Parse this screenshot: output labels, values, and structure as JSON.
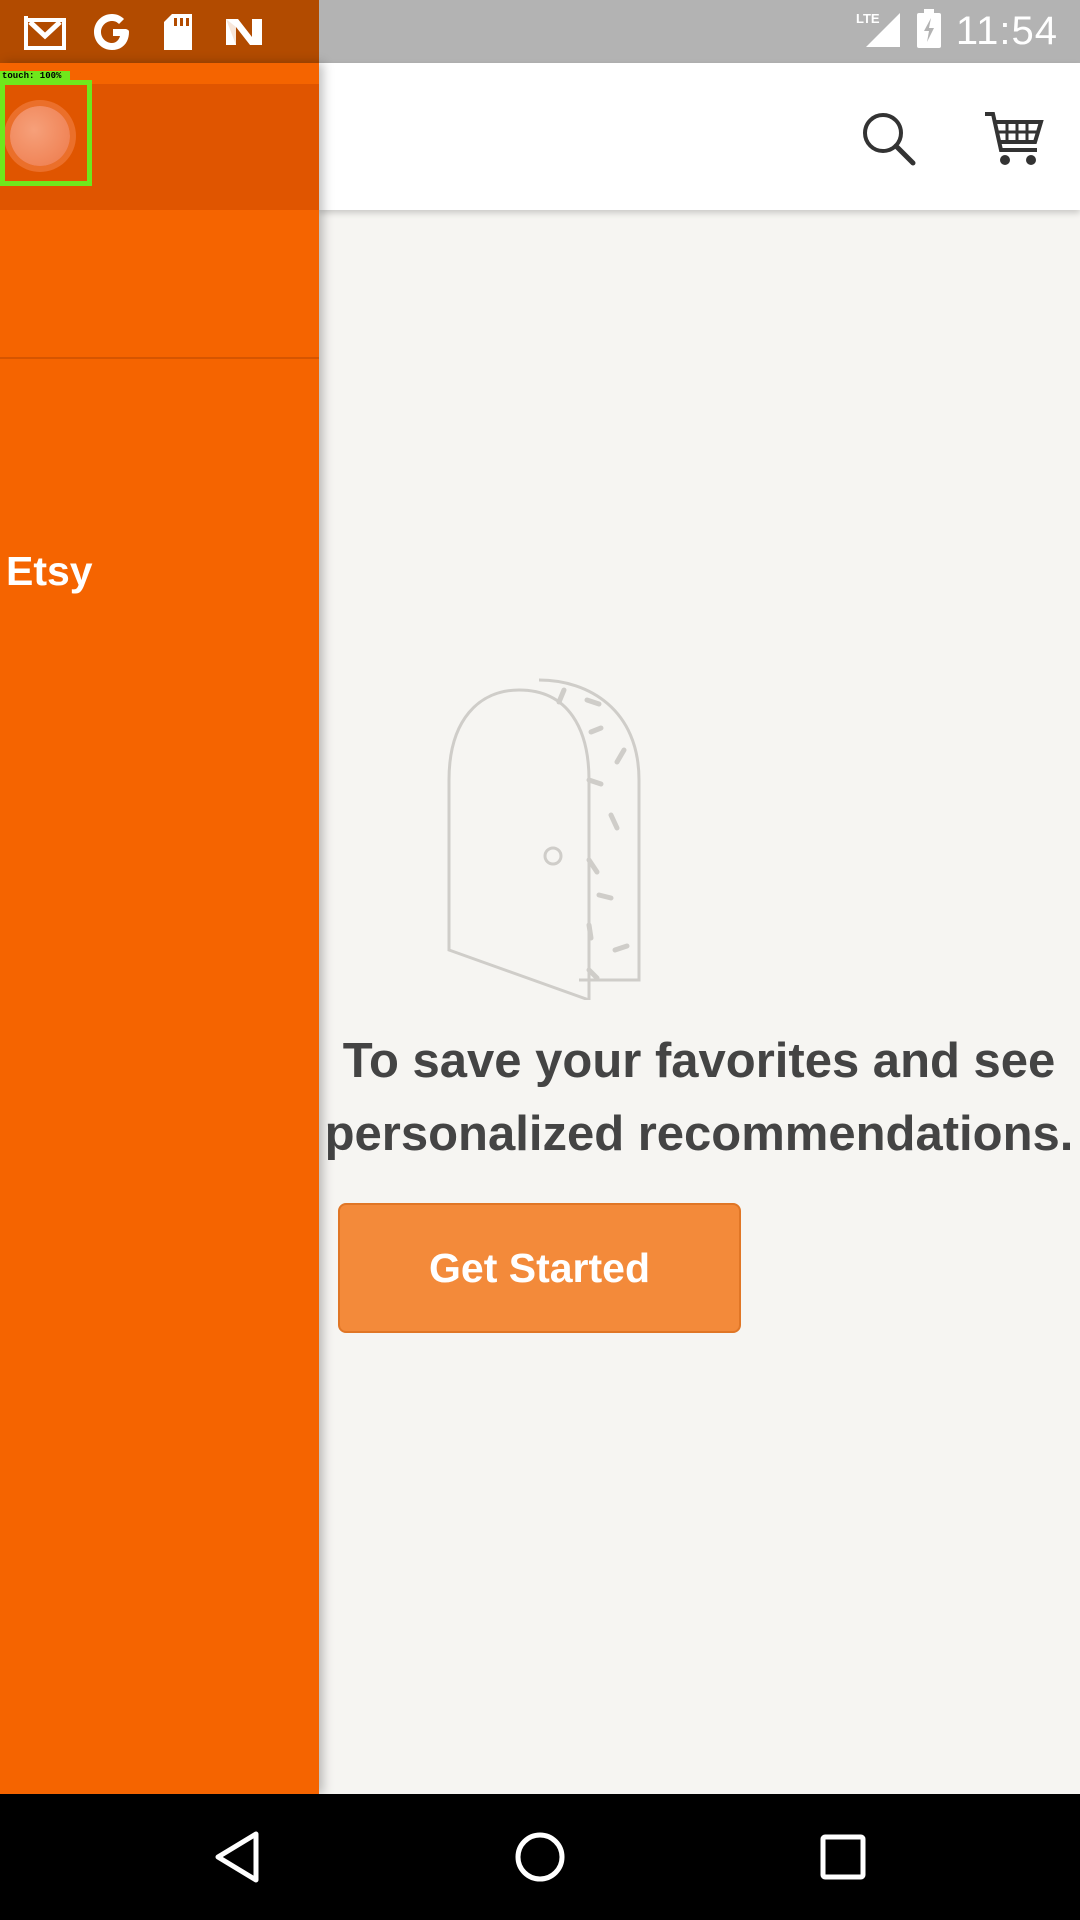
{
  "status_bar": {
    "time": "11:54",
    "network": "LTE",
    "notification_icons": [
      "gmail-icon",
      "google-icon",
      "sd-card-icon",
      "n-app-icon"
    ]
  },
  "app_bar": {
    "actions": [
      "search-icon",
      "cart-icon"
    ]
  },
  "drawer": {
    "touch_overlay": "touch: 100%",
    "items": [
      {
        "label": "Etsy"
      }
    ]
  },
  "empty_state": {
    "line1": "To save your favorites and see",
    "line2": "personalized recommendations.",
    "cta_label": "Get Started"
  },
  "nav_bar": {
    "buttons": [
      "back-icon",
      "home-icon",
      "recents-icon"
    ]
  },
  "colors": {
    "brand_orange": "#f56400",
    "button_orange": "#f38a3a",
    "text_dark": "#444444",
    "background": "#f6f5f2"
  }
}
